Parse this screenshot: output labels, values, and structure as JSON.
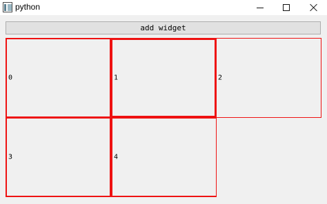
{
  "window": {
    "title": "python",
    "controls": {
      "minimize_icon": "minimize-icon",
      "maximize_icon": "maximize-icon",
      "close_icon": "close-icon"
    }
  },
  "toolbar": {
    "add_widget_label": "add widget"
  },
  "grid": {
    "cell_border_color": "#ee1111",
    "cells": [
      {
        "label": "0"
      },
      {
        "label": "1"
      },
      {
        "label": "2"
      },
      {
        "label": "3"
      },
      {
        "label": "4"
      }
    ]
  }
}
